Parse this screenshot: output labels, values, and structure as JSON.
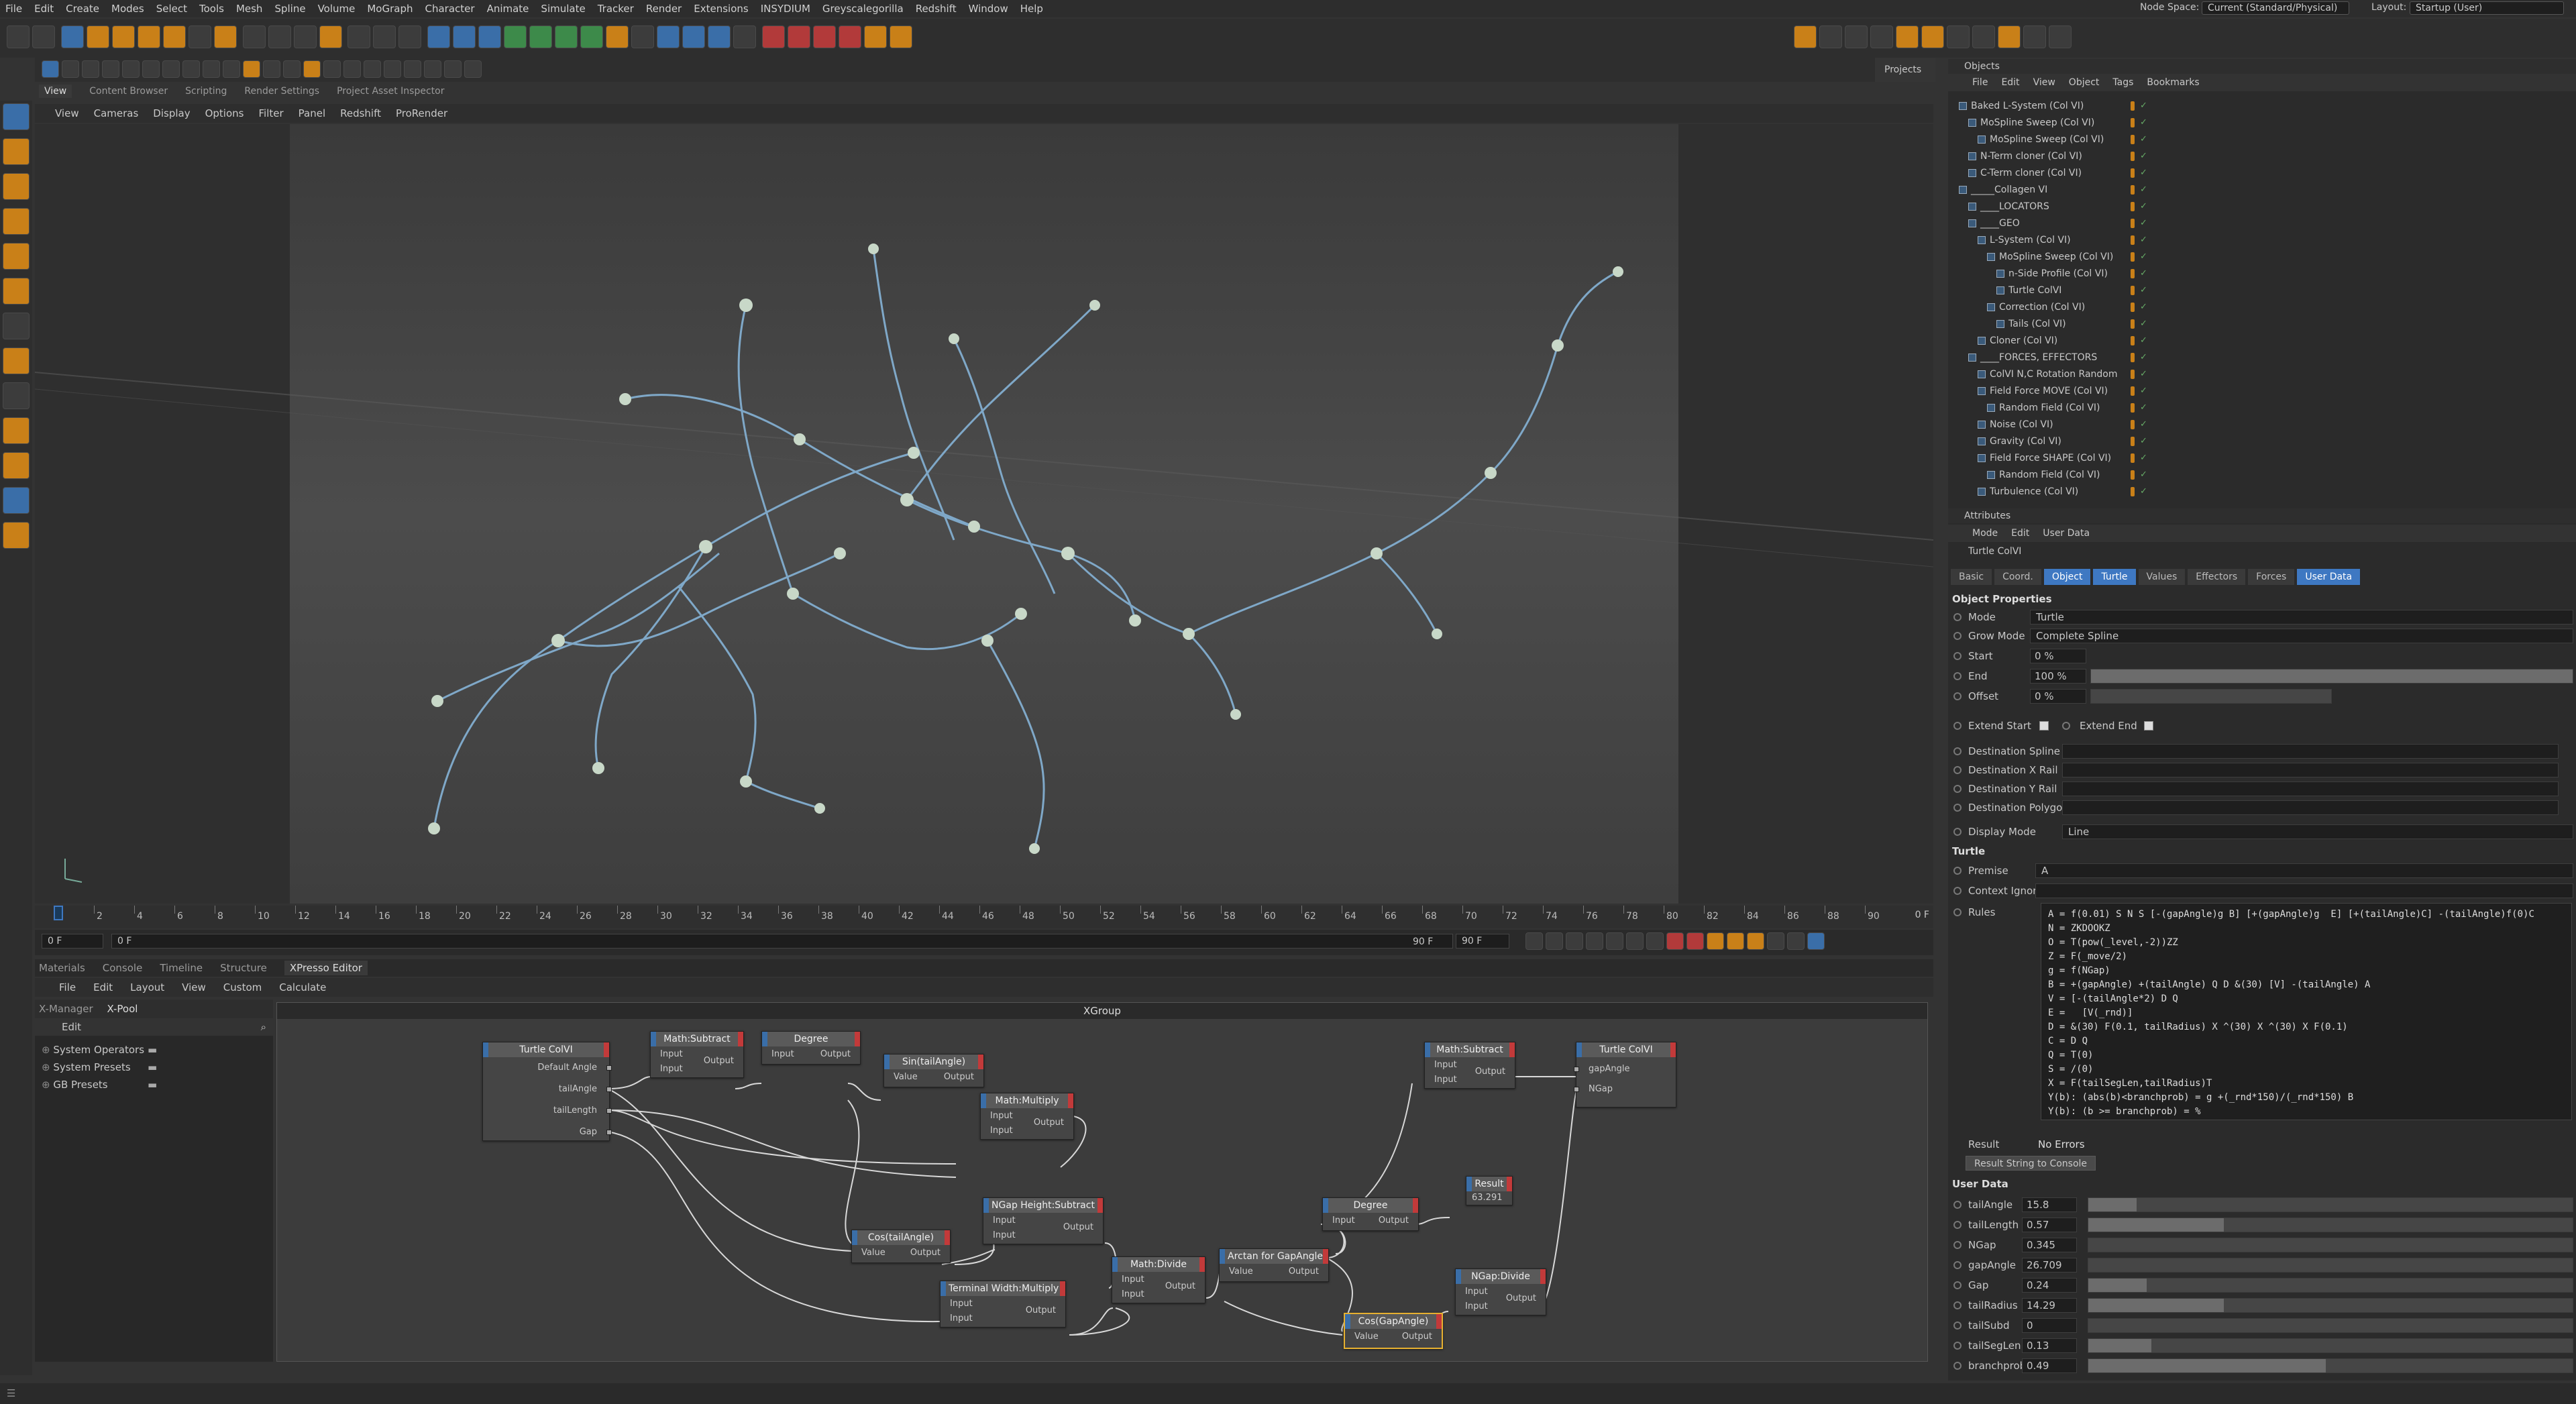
{
  "menu": [
    "File",
    "Edit",
    "Create",
    "Modes",
    "Select",
    "Tools",
    "Mesh",
    "Spline",
    "Volume",
    "MoGraph",
    "Character",
    "Animate",
    "Simulate",
    "Tracker",
    "Render",
    "Extensions",
    "INSYDIUM",
    "Greyscalegorilla",
    "Redshift",
    "Window",
    "Help"
  ],
  "node_space": {
    "label": "Node Space:",
    "value": "Current (Standard/Physical)"
  },
  "layout": {
    "label": "Layout:",
    "value": "Startup (User)"
  },
  "top_tabs": [
    "View",
    "Content Browser",
    "Scripting",
    "Render Settings",
    "Project Asset Inspector"
  ],
  "viewport_menu": [
    "View",
    "Cameras",
    "Display",
    "Options",
    "Filter",
    "Panel",
    "Redshift",
    "ProRender"
  ],
  "projects_label": "Projects",
  "timeline": {
    "ticks": [
      "0",
      "2",
      "4",
      "6",
      "8",
      "10",
      "12",
      "14",
      "16",
      "18",
      "20",
      "22",
      "24",
      "26",
      "28",
      "30",
      "32",
      "34",
      "36",
      "38",
      "40",
      "42",
      "44",
      "46",
      "48",
      "50",
      "52",
      "54",
      "56",
      "58",
      "60",
      "62",
      "64",
      "66",
      "68",
      "70",
      "72",
      "74",
      "76",
      "78",
      "80",
      "82",
      "84",
      "86",
      "88",
      "90"
    ],
    "end_frame": "0 F",
    "current": "0 F",
    "start": "0 F",
    "max1": "90 F",
    "max2": "90 F"
  },
  "bottom_tabs": [
    "Materials",
    "Console",
    "Timeline",
    "Structure",
    "XPresso Editor"
  ],
  "xp_menu": [
    "File",
    "Edit",
    "Layout",
    "View",
    "Custom",
    "Calculate"
  ],
  "xmanager": {
    "tabs": [
      "X-Manager",
      "X-Pool"
    ],
    "edit": "Edit",
    "items": [
      "System Operators",
      "System Presets",
      "GB Presets"
    ]
  },
  "xgroup_title": "XGroup",
  "nodes": {
    "turtle_in": {
      "title": "Turtle ColVI",
      "ports": [
        "Default Angle",
        "tailAngle",
        "tailLength",
        "Gap"
      ]
    },
    "math_sub1": {
      "title": "Math:Subtract",
      "in": [
        "Input",
        "Input"
      ],
      "out": "Output"
    },
    "degree1": {
      "title": "Degree",
      "in": [
        "Input"
      ],
      "out": "Output"
    },
    "sin": {
      "title": "Sin(tailAngle)",
      "in": [
        "Value"
      ],
      "out": "Output"
    },
    "math_mul": {
      "title": "Math:Multiply",
      "in": [
        "Input",
        "Input"
      ],
      "out": "Output"
    },
    "cos_tail": {
      "title": "Cos(tailAngle)",
      "in": [
        "Value"
      ],
      "out": "Output"
    },
    "ngap_sub": {
      "title": "NGap Height:Subtract",
      "in": [
        "Input",
        "Input"
      ],
      "out": "Output"
    },
    "term_mul": {
      "title": "Terminal Width:Multiply",
      "in": [
        "Input",
        "Input"
      ],
      "out": "Output"
    },
    "math_div": {
      "title": "Math:Divide",
      "in": [
        "Input",
        "Input"
      ],
      "out": "Output"
    },
    "arctan": {
      "title": "Arctan for GapAngle",
      "in": [
        "Value"
      ],
      "out": "Output"
    },
    "degree2": {
      "title": "Degree",
      "in": [
        "Input"
      ],
      "out": "Output"
    },
    "math_sub2": {
      "title": "Math:Subtract",
      "in": [
        "Input",
        "Input"
      ],
      "out": "Output"
    },
    "result": {
      "title": "Result",
      "value": "63.291"
    },
    "cos_gap": {
      "title": "Cos(GapAngle)",
      "in": [
        "Value"
      ],
      "out": "Output"
    },
    "ngap_div": {
      "title": "NGap:Divide",
      "in": [
        "Input",
        "Input"
      ],
      "out": "Output"
    },
    "turtle_out": {
      "title": "Turtle ColVI",
      "ports": [
        "gapAngle",
        "NGap"
      ]
    }
  },
  "objects_panel": {
    "title": "Objects",
    "menu": [
      "File",
      "Edit",
      "View",
      "Object",
      "Tags",
      "Bookmarks"
    ],
    "rows": [
      {
        "name": "Baked L-System (Col VI)",
        "indent": 0
      },
      {
        "name": "MoSpline Sweep (Col VI)",
        "indent": 1
      },
      {
        "name": "MoSpline Sweep (Col VI)",
        "indent": 2
      },
      {
        "name": "N-Term cloner (Col VI)",
        "indent": 1
      },
      {
        "name": "C-Term cloner (Col VI)",
        "indent": 1
      },
      {
        "name": "_____Collagen VI",
        "indent": 0
      },
      {
        "name": "____LOCATORS",
        "indent": 1
      },
      {
        "name": "____GEO",
        "indent": 1
      },
      {
        "name": "L-System (Col VI)",
        "indent": 2
      },
      {
        "name": "MoSpline Sweep (Col VI)",
        "indent": 3
      },
      {
        "name": "n-Side Profile (Col VI)",
        "indent": 4
      },
      {
        "name": "Turtle ColVI",
        "indent": 4
      },
      {
        "name": "Correction (Col VI)",
        "indent": 3
      },
      {
        "name": "Tails (Col VI)",
        "indent": 4
      },
      {
        "name": "Cloner (Col VI)",
        "indent": 2
      },
      {
        "name": "____FORCES, EFFECTORS",
        "indent": 1
      },
      {
        "name": "ColVI N,C Rotation Random",
        "indent": 2
      },
      {
        "name": "Field Force MOVE (Col VI)",
        "indent": 2
      },
      {
        "name": "Random Field (Col VI)",
        "indent": 3
      },
      {
        "name": "Noise (Col VI)",
        "indent": 2
      },
      {
        "name": "Gravity (Col VI)",
        "indent": 2
      },
      {
        "name": "Field Force SHAPE (Col VI)",
        "indent": 2
      },
      {
        "name": "Random Field (Col VI)",
        "indent": 3
      },
      {
        "name": "Turbulence (Col VI)",
        "indent": 2
      }
    ]
  },
  "attributes": {
    "title": "Attributes",
    "menu": [
      "Mode",
      "Edit",
      "User Data"
    ],
    "object_name": "Turtle ColVI",
    "tabs": [
      "Basic",
      "Coord.",
      "Object",
      "Turtle",
      "Values",
      "Effectors",
      "Forces",
      "User Data"
    ],
    "section_object": "Object Properties",
    "mode_label": "Mode",
    "mode_value": "Turtle",
    "grow_label": "Grow Mode",
    "grow_value": "Complete Spline",
    "start_label": "Start",
    "start_value": "0 %",
    "end_label": "End",
    "end_value": "100 %",
    "offset_label": "Offset",
    "offset_value": "0 %",
    "extend_start": "Extend Start",
    "extend_end": "Extend End",
    "dest_spline": "Destination Spline",
    "dest_x": "Destination X Rail",
    "dest_y": "Destination Y Rail",
    "dest_poly": "Destination Polygon",
    "display_label": "Display Mode",
    "display_value": "Line",
    "section_turtle": "Turtle",
    "premise_label": "Premise",
    "premise_value": "A",
    "context_label": "Context Ignore",
    "rules_label": "Rules",
    "rules": [
      "A = f(0.01) S N S [-(gapAngle)g B] [+(gapAngle)g  E] [+(tailAngle)C] -(tailAngle)f(0)C",
      "N = ZKDOOKZ",
      "O = T(pow(_level,-2))ZZ",
      "Z = F(_move/2)",
      "g = f(NGap)",
      "B = +(gapAngle) +(tailAngle) Q D &(30) [V] -(tailAngle) A",
      "V = [-(tailAngle*2) D Q",
      "E =   [V(_rnd)]",
      "D = &(30) F(0.1, tailRadius) X ^(30) X ^(30) X F(0.1)",
      "C = D Q",
      "Q = T(0)",
      "S = /(0)",
      "X = F(tailSegLen,tailRadius)T",
      "Y(b): (abs(b)<branchprob) = g +(_rnd*150)/(_rnd*150) B",
      "Y(b): (b >= branchprob) = %"
    ],
    "result_label": "Result",
    "result_value": "No Errors",
    "result_button": "Result String to Console",
    "section_user": "User Data",
    "user_data": [
      {
        "name": "tailAngle",
        "value": "15.8",
        "fill": 0.1
      },
      {
        "name": "tailLength",
        "value": "0.57",
        "fill": 0.28
      },
      {
        "name": "NGap",
        "value": "0.345",
        "fill": 0
      },
      {
        "name": "gapAngle",
        "value": "26.709",
        "fill": 0
      },
      {
        "name": "Gap",
        "value": "0.24",
        "fill": 0.12
      },
      {
        "name": "tailRadius",
        "value": "14.29",
        "fill": 0.28
      },
      {
        "name": "tailSubd",
        "value": "0",
        "fill": 0
      },
      {
        "name": "tailSegLen",
        "value": "0.13",
        "fill": 0.13
      },
      {
        "name": "branchprob",
        "value": "0.49",
        "fill": 0.49
      }
    ]
  },
  "colors": {
    "accent": "#3e78c2",
    "orange": "#c98018",
    "bg": "#333333"
  }
}
